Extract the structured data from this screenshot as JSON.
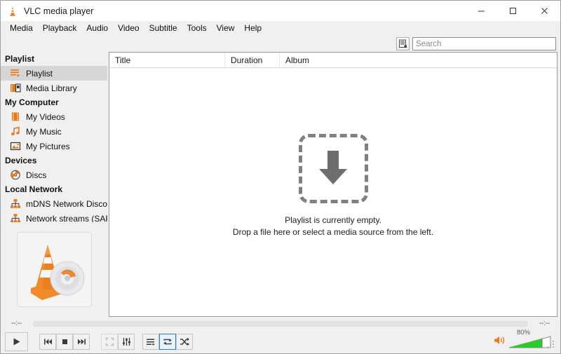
{
  "window": {
    "title": "VLC media player",
    "app_icon": "vlc-cone-icon",
    "minimize_label": "–",
    "maximize_label": "☐",
    "close_label": "✕"
  },
  "menubar": {
    "items": [
      {
        "label": "Media",
        "name": "menu-media"
      },
      {
        "label": "Playback",
        "name": "menu-playback"
      },
      {
        "label": "Audio",
        "name": "menu-audio"
      },
      {
        "label": "Video",
        "name": "menu-video"
      },
      {
        "label": "Subtitle",
        "name": "menu-subtitle"
      },
      {
        "label": "Tools",
        "name": "menu-tools"
      },
      {
        "label": "View",
        "name": "menu-view"
      },
      {
        "label": "Help",
        "name": "menu-help"
      }
    ]
  },
  "toolbar": {
    "filter_icon": "playlist-view-mode-icon",
    "search": {
      "value": "",
      "placeholder": "Search"
    }
  },
  "sidebar": {
    "sections": [
      {
        "header": "Playlist",
        "items": [
          {
            "label": "Playlist",
            "icon": "playlist-icon",
            "selected": true
          },
          {
            "label": "Media Library",
            "icon": "media-library-icon",
            "selected": false
          }
        ]
      },
      {
        "header": "My Computer",
        "items": [
          {
            "label": "My Videos",
            "icon": "film-strip-icon",
            "selected": false
          },
          {
            "label": "My Music",
            "icon": "music-note-icon",
            "selected": false
          },
          {
            "label": "My Pictures",
            "icon": "picture-icon",
            "selected": false
          }
        ]
      },
      {
        "header": "Devices",
        "items": [
          {
            "label": "Discs",
            "icon": "disc-icon",
            "selected": false
          }
        ]
      },
      {
        "header": "Local Network",
        "items": [
          {
            "label": "mDNS Network Disco...",
            "icon": "network-icon",
            "selected": false
          },
          {
            "label": "Network streams (SAP)",
            "icon": "network-icon",
            "selected": false
          }
        ]
      }
    ],
    "scrollbar": {
      "up_arrow": "⌃",
      "down_arrow": "⌄"
    },
    "artwork": {
      "name": "vlc-cone-artwork"
    }
  },
  "playlist": {
    "columns": [
      {
        "label": "Title"
      },
      {
        "label": "Duration"
      },
      {
        "label": "Album"
      }
    ],
    "rows": [],
    "empty_state": {
      "icon": "download-arrow-icon",
      "line1": "Playlist is currently empty.",
      "line2": "Drop a file here or select a media source from the left."
    }
  },
  "controls": {
    "time_elapsed": "--:--",
    "time_total": "--:--",
    "seek_position_pct": 0,
    "buttons": [
      {
        "name": "play-button",
        "icon": "play-icon",
        "state": "normal"
      },
      {
        "name": "previous-button",
        "icon": "previous-icon",
        "state": "normal"
      },
      {
        "name": "stop-button",
        "icon": "stop-icon",
        "state": "normal"
      },
      {
        "name": "next-button",
        "icon": "next-icon",
        "state": "normal"
      },
      {
        "name": "fullscreen-button",
        "icon": "fullscreen-icon",
        "state": "disabled"
      },
      {
        "name": "extended-settings-button",
        "icon": "equalizer-icon",
        "state": "normal"
      },
      {
        "name": "toggle-playlist-button",
        "icon": "playlist-toggle-icon",
        "state": "normal"
      },
      {
        "name": "loop-button",
        "icon": "loop-icon",
        "state": "active"
      },
      {
        "name": "shuffle-button",
        "icon": "shuffle-icon",
        "state": "normal"
      }
    ],
    "volume": {
      "level_label": "80%",
      "level": 80,
      "icon": "speaker-icon"
    }
  },
  "colors": {
    "accent_orange": "#e8781a",
    "volume_green": "#2fc92f",
    "active_blue": "#2a7fd4",
    "window_bg": "#f0f0f0",
    "panel_bg": "#ffffff",
    "dropzone_gray": "#808080"
  }
}
